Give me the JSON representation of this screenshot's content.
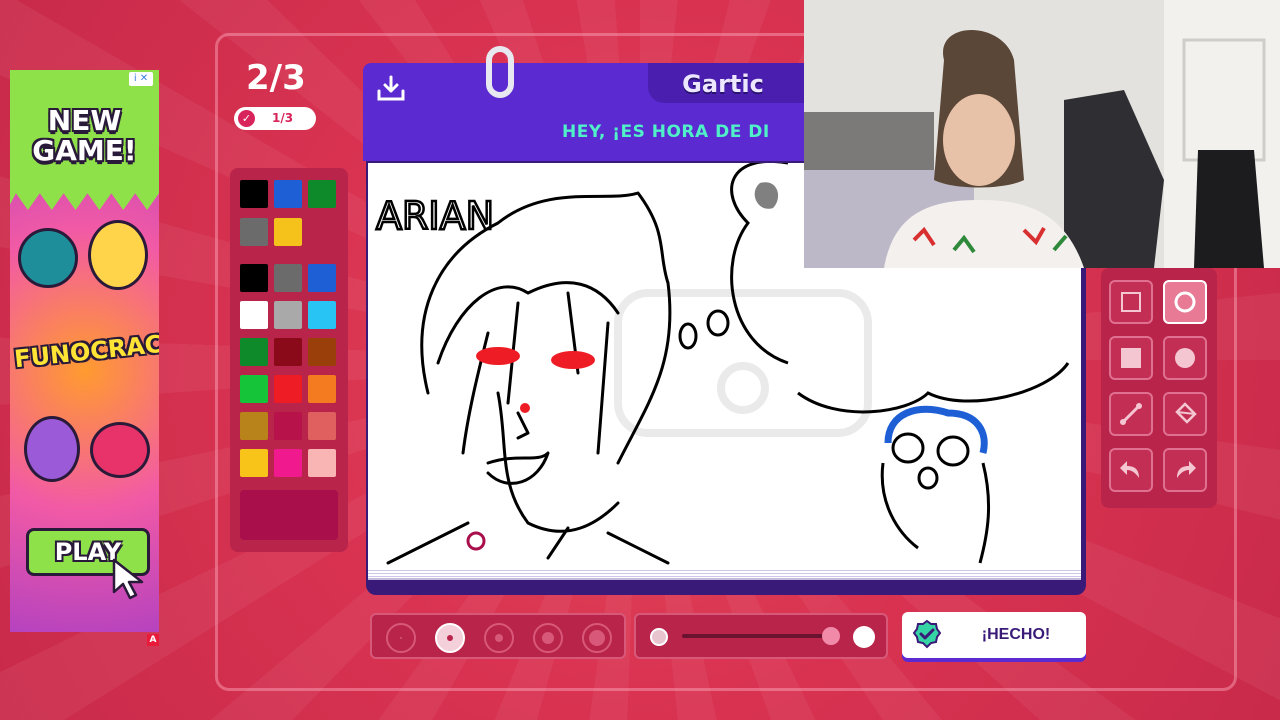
{
  "ad": {
    "info_label": "i ✕",
    "title": "NEW\nGAME!",
    "logo_text": "FUNOCRACY",
    "play_label": "PLAY",
    "badge": "A"
  },
  "round": {
    "counter": "2/3",
    "sub_counter": "1/3"
  },
  "board": {
    "brand": "Gartic",
    "prompt": "HEY, ¡ES HORA DE DI",
    "drawing_text": "ARIAN"
  },
  "palette": {
    "colors": [
      "#000000",
      "#1e5fd6",
      "#0f8a2a",
      "#6b6b6b",
      "#f5c21b",
      "#000000",
      "#6b6b6b",
      "#1e5fd6",
      "#ffffff",
      "#a9a9a9",
      "#27c4f4",
      "#0f8a2a",
      "#8a0a1a",
      "#9a3f0a",
      "#16c43a",
      "#ee1c24",
      "#f57b20",
      "#b8831a",
      "#b8124a",
      "#e06060",
      "#f9c41a",
      "#f01a8e",
      "#f9b4b4"
    ],
    "current_color": "#a80f4b"
  },
  "done_button": {
    "label": "¡HECHO!"
  },
  "colors": {
    "background": "#d93351",
    "board_header": "#5b2ad1",
    "prompt": "#50f0c8",
    "panel": "#b8244a"
  }
}
